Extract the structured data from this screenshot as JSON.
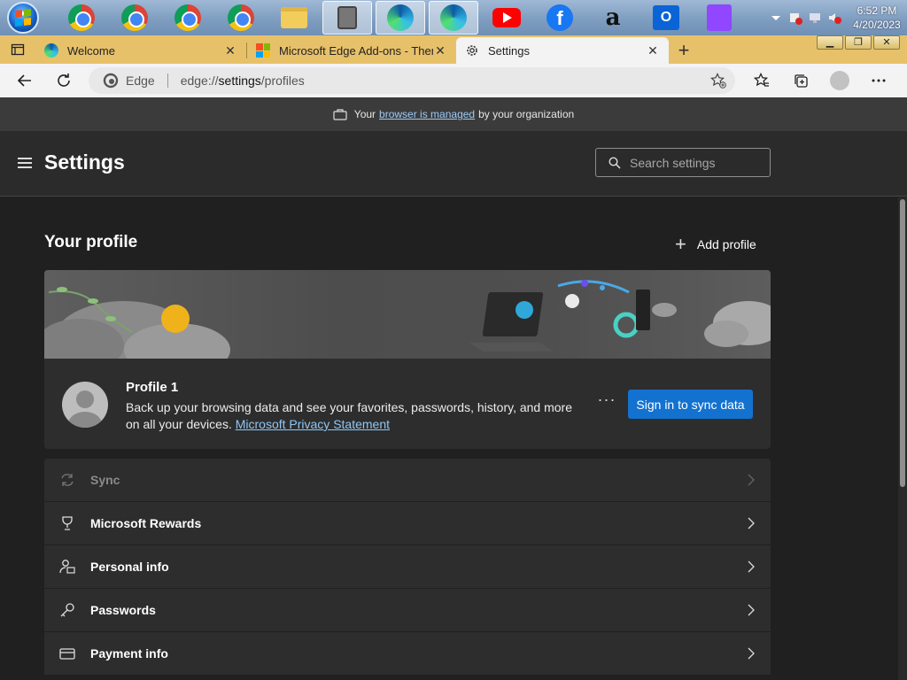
{
  "taskbar": {
    "clock_time": "6:52 PM",
    "clock_date": "4/20/2023",
    "amazon_glyph": "a",
    "outlook_glyph": "O",
    "facebook_glyph": "f"
  },
  "tabs": [
    {
      "label": "Welcome",
      "close": "✕"
    },
    {
      "label": "Microsoft Edge Add-ons - Themes",
      "close": "✕"
    },
    {
      "label": "Settings",
      "close": "✕"
    }
  ],
  "new_tab_glyph": "+",
  "addressbar": {
    "site_label": "Edge",
    "url_prefix": "edge://",
    "url_host": "settings",
    "url_path": "/profiles"
  },
  "managed_bar": {
    "prefix": "Your",
    "link": "browser is managed",
    "suffix": "by your organization"
  },
  "settings": {
    "title": "Settings",
    "search_placeholder": "Search settings"
  },
  "profile_section": {
    "title": "Your profile",
    "add_profile": "Add profile",
    "profile_name": "Profile 1",
    "description": "Back up your browsing data and see your favorites, passwords, history, and more on all your devices.",
    "privacy_link": "Microsoft Privacy Statement",
    "more_glyph": "···",
    "sign_in_button": "Sign in to sync data"
  },
  "settings_items": [
    {
      "label": "Sync",
      "icon": "sync-icon",
      "disabled": true
    },
    {
      "label": "Microsoft Rewards",
      "icon": "trophy-icon",
      "disabled": false
    },
    {
      "label": "Personal info",
      "icon": "personal-info-icon",
      "disabled": false
    },
    {
      "label": "Passwords",
      "icon": "key-icon",
      "disabled": false
    },
    {
      "label": "Payment info",
      "icon": "card-icon",
      "disabled": false
    }
  ],
  "colors": {
    "accent": "#1372d0",
    "link": "#8fc7f6",
    "theme_tabstrip": "#e7c16a"
  }
}
